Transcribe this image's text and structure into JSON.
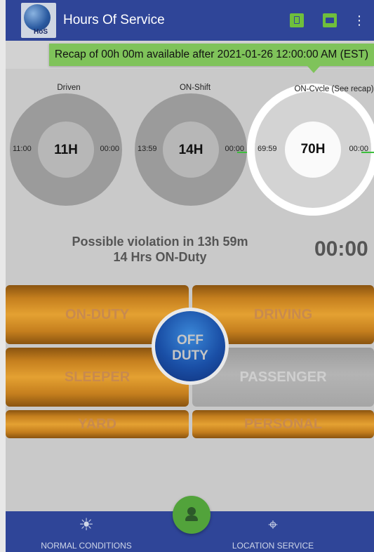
{
  "app": {
    "title": "Hours Of Service",
    "logo_text": "HoS"
  },
  "toolbar": {
    "tablet_icon": "tablet-icon",
    "truck_icon": "truck-icon",
    "menu_icon": "more-vert-icon",
    "menu_glyph": "⋮"
  },
  "recap": {
    "text": "Recap of 00h 00m available after 2021-01-26 12:00:00 AM (EST)"
  },
  "gauges": [
    {
      "label": "Driven",
      "left_value": "11:00",
      "center": "11H",
      "right_value": "00:00"
    },
    {
      "label": "ON-Shift",
      "left_value": "13:59",
      "center": "14H",
      "right_value": "00:00"
    },
    {
      "label": "ON-Cycle (See recap)",
      "left_value": "69:59",
      "center": "70H",
      "right_value": "00:00"
    }
  ],
  "violation": {
    "line1": "Possible violation in 13h 59m",
    "line2": "14 Hrs ON-Duty",
    "timer": "00:00"
  },
  "duty": {
    "on_duty": "ON-DUTY",
    "driving": "DRIVING",
    "sleeper": "SLEEPER",
    "passenger": "PASSENGER",
    "yard": "YARD",
    "personal": "PERSONAL",
    "off_duty": "OFF DUTY"
  },
  "bottom_nav": {
    "normal_conditions": "NORMAL CONDITIONS",
    "location_service": "LOCATION SERVICE"
  },
  "colors": {
    "appbar": "#2f4598",
    "accent_green": "#7fc35a",
    "duty_orange": "#e4a132",
    "off_duty_blue": "#1a4fa6"
  }
}
